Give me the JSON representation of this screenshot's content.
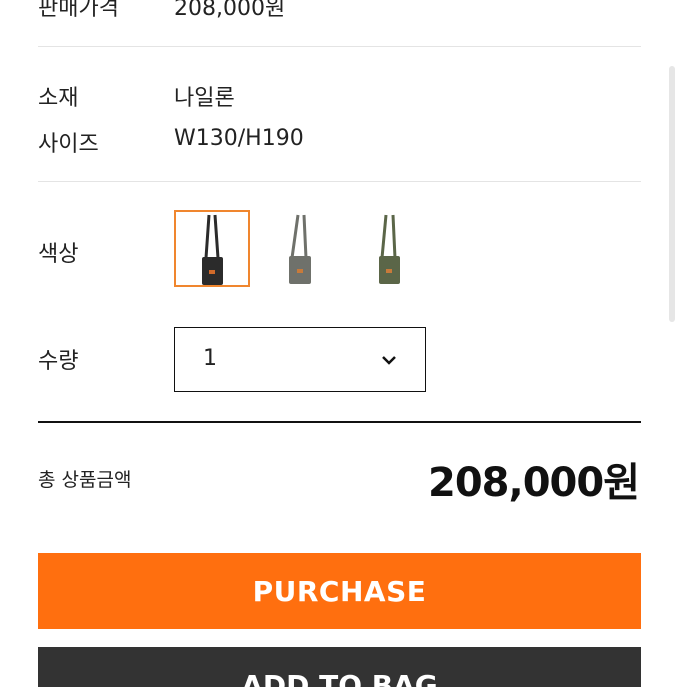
{
  "product": {
    "price_label": "판매가격",
    "price_value": "208,000원",
    "material_label": "소재",
    "material_value": "나일론",
    "size_label": "사이즈",
    "size_value": "W130/H190"
  },
  "options": {
    "color_label": "색상",
    "colors": [
      {
        "name": "black",
        "hex": "#2b2b2b",
        "selected": true
      },
      {
        "name": "gray",
        "hex": "#6f716b",
        "selected": false
      },
      {
        "name": "khaki",
        "hex": "#5b6648",
        "selected": false
      }
    ],
    "quantity_label": "수량",
    "quantity_value": "1"
  },
  "summary": {
    "total_label": "총 상품금액",
    "total_value": "208,000원"
  },
  "actions": {
    "purchase_label": "PURCHASE",
    "cart_label": "ADD TO BAG"
  },
  "colors": {
    "accent": "#ff6f0f",
    "selected_border": "#f0862e",
    "dark_button": "#333333"
  }
}
